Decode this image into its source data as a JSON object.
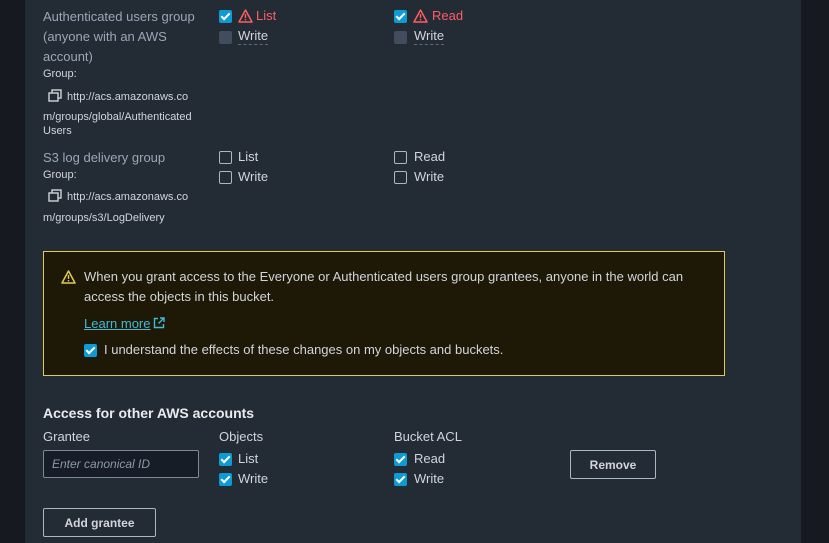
{
  "auth_group": {
    "title_line1": "Authenticated users group",
    "title_line2": "(anyone with an AWS",
    "title_line3": "account)",
    "group_label": "Group:",
    "url_line1": "http://acs.amazonaws.co",
    "url_line2": "m/groups/global/Authenticated",
    "url_line3": "Users",
    "objects_list": "List",
    "objects_write": "Write",
    "acl_read": "Read",
    "acl_write": "Write"
  },
  "log_group": {
    "title": "S3 log delivery group",
    "group_label": "Group:",
    "url_line1": "http://acs.amazonaws.co",
    "url_line2": "m/groups/s3/LogDelivery",
    "objects_list": "List",
    "objects_write": "Write",
    "acl_read": "Read",
    "acl_write": "Write"
  },
  "warning": {
    "text_line1": "When you grant access to the Everyone or Authenticated users group grantees, anyone in the world can",
    "text_line2": "access the objects in this bucket.",
    "learn_more": "Learn more",
    "ack": "I understand the effects of these changes on my objects and buckets.",
    "ack_checked": true
  },
  "other_accounts": {
    "heading": "Access for other AWS accounts",
    "col_grantee": "Grantee",
    "col_objects": "Objects",
    "col_acl": "Bucket ACL",
    "grantee_placeholder": "Enter canonical ID",
    "objects_list": "List",
    "objects_write": "Write",
    "acl_read": "Read",
    "acl_write": "Write",
    "remove": "Remove",
    "add": "Add grantee"
  },
  "colors": {
    "accent": "#0d9bd8",
    "warning_border": "#e0ca57",
    "error": "#ff5d64",
    "link": "#44b9d6"
  }
}
